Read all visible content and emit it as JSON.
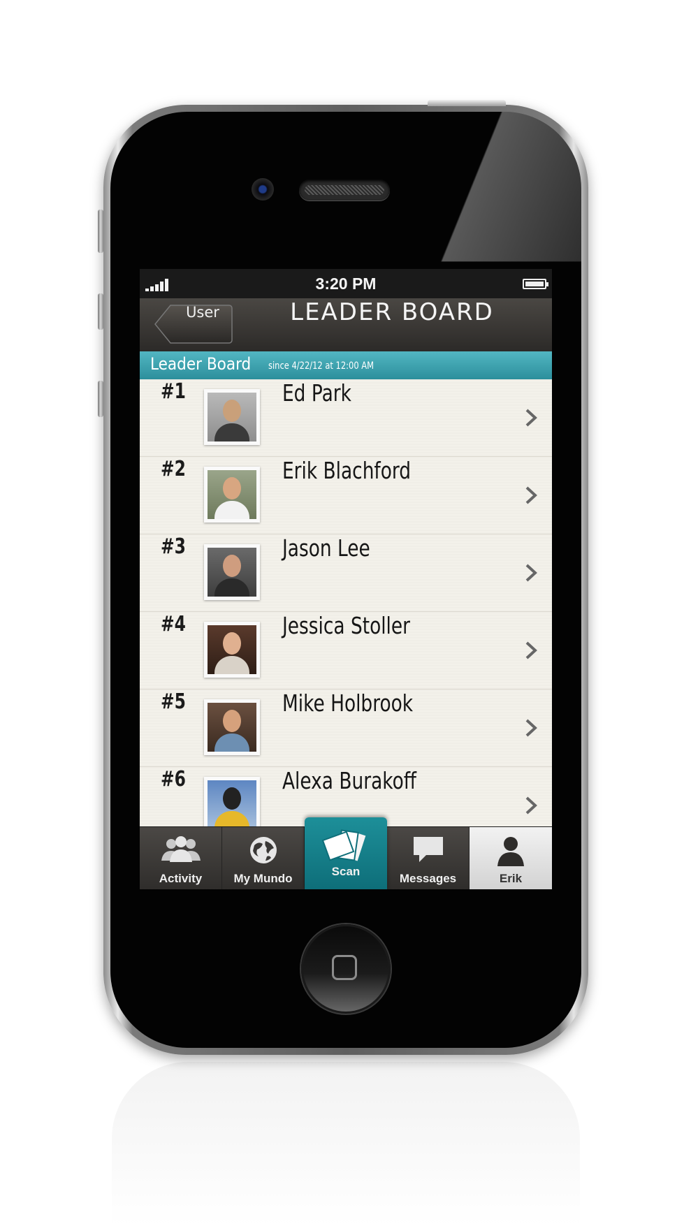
{
  "status_bar": {
    "time": "3:20 PM"
  },
  "nav_bar": {
    "back_label": "User",
    "title": "LEADER BOARD"
  },
  "section_header": {
    "title": "Leader Board",
    "subtitle": "since 4/22/12 at 12:00 AM"
  },
  "leaderboard": [
    {
      "rank": "#1",
      "name": "Ed Park"
    },
    {
      "rank": "#2",
      "name": "Erik Blachford"
    },
    {
      "rank": "#3",
      "name": "Jason Lee"
    },
    {
      "rank": "#4",
      "name": "Jessica Stoller"
    },
    {
      "rank": "#5",
      "name": "Mike Holbrook"
    },
    {
      "rank": "#6",
      "name": "Alexa Burakoff"
    }
  ],
  "tab_bar": {
    "tabs": [
      {
        "label": "Activity",
        "icon": "people-icon"
      },
      {
        "label": "My Mundo",
        "icon": "globe-icon"
      },
      {
        "label": "Scan",
        "icon": "cards-icon"
      },
      {
        "label": "Messages",
        "icon": "speech-bubble-icon"
      },
      {
        "label": "Erik",
        "icon": "person-icon"
      }
    ],
    "active": "Erik"
  },
  "colors": {
    "accent": "#2c8f9c",
    "nav_bg": "#2c2a28",
    "list_bg": "#f3f1ea"
  }
}
